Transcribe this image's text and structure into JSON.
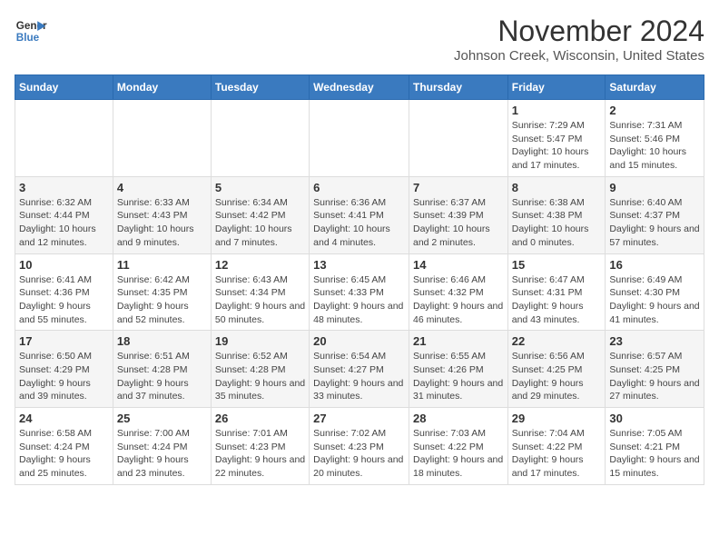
{
  "logo": {
    "line1": "General",
    "line2": "Blue"
  },
  "title": {
    "month": "November 2024",
    "location": "Johnson Creek, Wisconsin, United States"
  },
  "weekdays": [
    "Sunday",
    "Monday",
    "Tuesday",
    "Wednesday",
    "Thursday",
    "Friday",
    "Saturday"
  ],
  "weeks": [
    [
      {
        "day": "",
        "info": ""
      },
      {
        "day": "",
        "info": ""
      },
      {
        "day": "",
        "info": ""
      },
      {
        "day": "",
        "info": ""
      },
      {
        "day": "",
        "info": ""
      },
      {
        "day": "1",
        "info": "Sunrise: 7:29 AM\nSunset: 5:47 PM\nDaylight: 10 hours and 17 minutes."
      },
      {
        "day": "2",
        "info": "Sunrise: 7:31 AM\nSunset: 5:46 PM\nDaylight: 10 hours and 15 minutes."
      }
    ],
    [
      {
        "day": "3",
        "info": "Sunrise: 6:32 AM\nSunset: 4:44 PM\nDaylight: 10 hours and 12 minutes."
      },
      {
        "day": "4",
        "info": "Sunrise: 6:33 AM\nSunset: 4:43 PM\nDaylight: 10 hours and 9 minutes."
      },
      {
        "day": "5",
        "info": "Sunrise: 6:34 AM\nSunset: 4:42 PM\nDaylight: 10 hours and 7 minutes."
      },
      {
        "day": "6",
        "info": "Sunrise: 6:36 AM\nSunset: 4:41 PM\nDaylight: 10 hours and 4 minutes."
      },
      {
        "day": "7",
        "info": "Sunrise: 6:37 AM\nSunset: 4:39 PM\nDaylight: 10 hours and 2 minutes."
      },
      {
        "day": "8",
        "info": "Sunrise: 6:38 AM\nSunset: 4:38 PM\nDaylight: 10 hours and 0 minutes."
      },
      {
        "day": "9",
        "info": "Sunrise: 6:40 AM\nSunset: 4:37 PM\nDaylight: 9 hours and 57 minutes."
      }
    ],
    [
      {
        "day": "10",
        "info": "Sunrise: 6:41 AM\nSunset: 4:36 PM\nDaylight: 9 hours and 55 minutes."
      },
      {
        "day": "11",
        "info": "Sunrise: 6:42 AM\nSunset: 4:35 PM\nDaylight: 9 hours and 52 minutes."
      },
      {
        "day": "12",
        "info": "Sunrise: 6:43 AM\nSunset: 4:34 PM\nDaylight: 9 hours and 50 minutes."
      },
      {
        "day": "13",
        "info": "Sunrise: 6:45 AM\nSunset: 4:33 PM\nDaylight: 9 hours and 48 minutes."
      },
      {
        "day": "14",
        "info": "Sunrise: 6:46 AM\nSunset: 4:32 PM\nDaylight: 9 hours and 46 minutes."
      },
      {
        "day": "15",
        "info": "Sunrise: 6:47 AM\nSunset: 4:31 PM\nDaylight: 9 hours and 43 minutes."
      },
      {
        "day": "16",
        "info": "Sunrise: 6:49 AM\nSunset: 4:30 PM\nDaylight: 9 hours and 41 minutes."
      }
    ],
    [
      {
        "day": "17",
        "info": "Sunrise: 6:50 AM\nSunset: 4:29 PM\nDaylight: 9 hours and 39 minutes."
      },
      {
        "day": "18",
        "info": "Sunrise: 6:51 AM\nSunset: 4:28 PM\nDaylight: 9 hours and 37 minutes."
      },
      {
        "day": "19",
        "info": "Sunrise: 6:52 AM\nSunset: 4:28 PM\nDaylight: 9 hours and 35 minutes."
      },
      {
        "day": "20",
        "info": "Sunrise: 6:54 AM\nSunset: 4:27 PM\nDaylight: 9 hours and 33 minutes."
      },
      {
        "day": "21",
        "info": "Sunrise: 6:55 AM\nSunset: 4:26 PM\nDaylight: 9 hours and 31 minutes."
      },
      {
        "day": "22",
        "info": "Sunrise: 6:56 AM\nSunset: 4:25 PM\nDaylight: 9 hours and 29 minutes."
      },
      {
        "day": "23",
        "info": "Sunrise: 6:57 AM\nSunset: 4:25 PM\nDaylight: 9 hours and 27 minutes."
      }
    ],
    [
      {
        "day": "24",
        "info": "Sunrise: 6:58 AM\nSunset: 4:24 PM\nDaylight: 9 hours and 25 minutes."
      },
      {
        "day": "25",
        "info": "Sunrise: 7:00 AM\nSunset: 4:24 PM\nDaylight: 9 hours and 23 minutes."
      },
      {
        "day": "26",
        "info": "Sunrise: 7:01 AM\nSunset: 4:23 PM\nDaylight: 9 hours and 22 minutes."
      },
      {
        "day": "27",
        "info": "Sunrise: 7:02 AM\nSunset: 4:23 PM\nDaylight: 9 hours and 20 minutes."
      },
      {
        "day": "28",
        "info": "Sunrise: 7:03 AM\nSunset: 4:22 PM\nDaylight: 9 hours and 18 minutes."
      },
      {
        "day": "29",
        "info": "Sunrise: 7:04 AM\nSunset: 4:22 PM\nDaylight: 9 hours and 17 minutes."
      },
      {
        "day": "30",
        "info": "Sunrise: 7:05 AM\nSunset: 4:21 PM\nDaylight: 9 hours and 15 minutes."
      }
    ]
  ]
}
